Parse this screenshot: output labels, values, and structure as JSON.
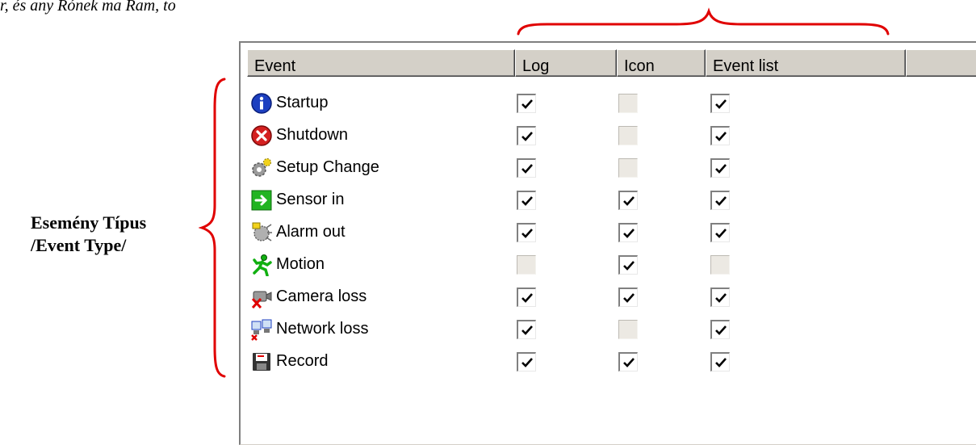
{
  "top_text": "r, és any Rónek ma Ram, to",
  "annotation": {
    "line1": "Esemény Típus",
    "line2": "/Event Type/"
  },
  "columns": [
    "Event",
    "Log",
    "Icon",
    "Event list"
  ],
  "events": [
    {
      "label": "Startup",
      "icon": "info-icon",
      "log": true,
      "icon_col": false,
      "event_list": true
    },
    {
      "label": "Shutdown",
      "icon": "shutdown-icon",
      "log": true,
      "icon_col": false,
      "event_list": true
    },
    {
      "label": "Setup Change",
      "icon": "gear-icon",
      "log": true,
      "icon_col": false,
      "event_list": true
    },
    {
      "label": "Sensor in",
      "icon": "sensor-arrow-icon",
      "log": true,
      "icon_col": true,
      "event_list": true
    },
    {
      "label": "Alarm out",
      "icon": "alarm-icon",
      "log": true,
      "icon_col": true,
      "event_list": true
    },
    {
      "label": "Motion",
      "icon": "running-man-icon",
      "log": false,
      "icon_col": true,
      "event_list": false
    },
    {
      "label": "Camera loss",
      "icon": "camera-loss-icon",
      "log": true,
      "icon_col": true,
      "event_list": true
    },
    {
      "label": "Network loss",
      "icon": "network-loss-icon",
      "log": true,
      "icon_col": false,
      "event_list": true
    },
    {
      "label": "Record",
      "icon": "floppy-disk-icon",
      "log": true,
      "icon_col": true,
      "event_list": true
    }
  ],
  "colors": {
    "bracket": "#e00000",
    "header_bg": "#d4d0c8"
  }
}
